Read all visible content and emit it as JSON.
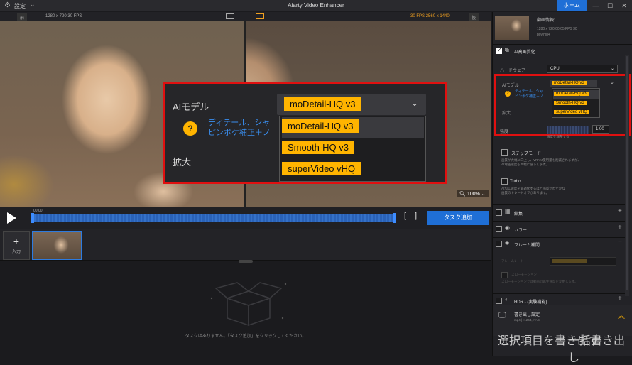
{
  "titlebar": {
    "settings_label": "設定",
    "title": "Aiarty Video Enhancer",
    "home_label": "ホーム",
    "minimize": "—",
    "maximize": "☐",
    "close": "✕"
  },
  "preview": {
    "before_tag": "前",
    "after_tag": "後",
    "before_info": "1280 x 720  30 FPS",
    "after_info": "30 FPS  2560 x 1440",
    "zoom_level": "100%"
  },
  "magnified": {
    "ai_model_label": "AIモデル",
    "selected_model": "moDetail-HQ  v3",
    "help_text_line1": "ディテール、シャ",
    "help_text_line2": "ピンボケ補正＋ノ",
    "scale_label": "拡大",
    "options": [
      "moDetail-HQ  v3",
      "Smooth-HQ  v3",
      "superVideo vHQ"
    ]
  },
  "playback": {
    "time": "00:00",
    "bracket_in": "[",
    "bracket_out": "]",
    "add_task_label": "タスク追加"
  },
  "strip": {
    "add_label": "入力",
    "add_plus": "+"
  },
  "empty": {
    "message": "タスクはありません。「タスク追加」をクリックしてください。"
  },
  "panel": {
    "media_info": {
      "heading": "動画情報:",
      "line1": "1280 x 720  00:05  FPS 30",
      "line2": "boy.mp4"
    },
    "ai_enhance": {
      "title": "AI高画質化",
      "hardware_label": "ハードウェア",
      "hardware_value": "CPU",
      "ai_model_label": "AIモデル",
      "selected_model": "moDetail-HQ  v3",
      "help_text_line1": "ディテール、シャ",
      "help_text_line2": "ピンボケ補正＋ノ",
      "scale_label": "拡大",
      "options": [
        "moDetail-HQ  v3",
        "Smooth-HQ  v3",
        "superVideo vHQ"
      ],
      "strength_label": "強度",
      "strength_value": "1.00",
      "strength_hint": "強度を調整する"
    },
    "step_mode": {
      "title": "ステップモード",
      "desc1": "画質が大幅に向上し、VRAM使用量も削減されますが、",
      "desc2": "AI増強速度も大幅に低下します。"
    },
    "turbo": {
      "title": "Turbo",
      "desc1": "AI加工速度を最適化するほど画質がわずかな",
      "desc2": "画質のトレードオフがあります。"
    },
    "sections": {
      "edit": "編集",
      "color": "カラー",
      "frame_interp": "フレーム補間",
      "frame_rate_label": "フレームレート",
      "slowmo_label": "スローモーション",
      "slowmo_desc": "スローモーションでは動画の再生速度を変更します。",
      "hdr": "HDR - (実験機能)"
    },
    "export": {
      "title": "書き出し設定",
      "format": "mp4 | H.264, AAC"
    },
    "export_selected_label": "選択項目を書き出す",
    "export_all_label": "一括書き出し"
  }
}
